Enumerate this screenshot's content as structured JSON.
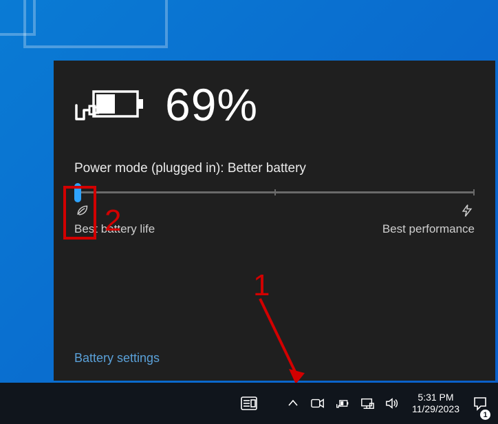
{
  "battery": {
    "percent_text": "69%",
    "mode_label": "Power mode (plugged in): Better battery",
    "left_caption": "Best battery life",
    "right_caption": "Best performance",
    "settings_link": "Battery settings"
  },
  "taskbar": {
    "time": "5:31 PM",
    "date": "11/29/2023",
    "notification_count": "1"
  },
  "annotations": {
    "label1": "1",
    "label2": "2"
  }
}
